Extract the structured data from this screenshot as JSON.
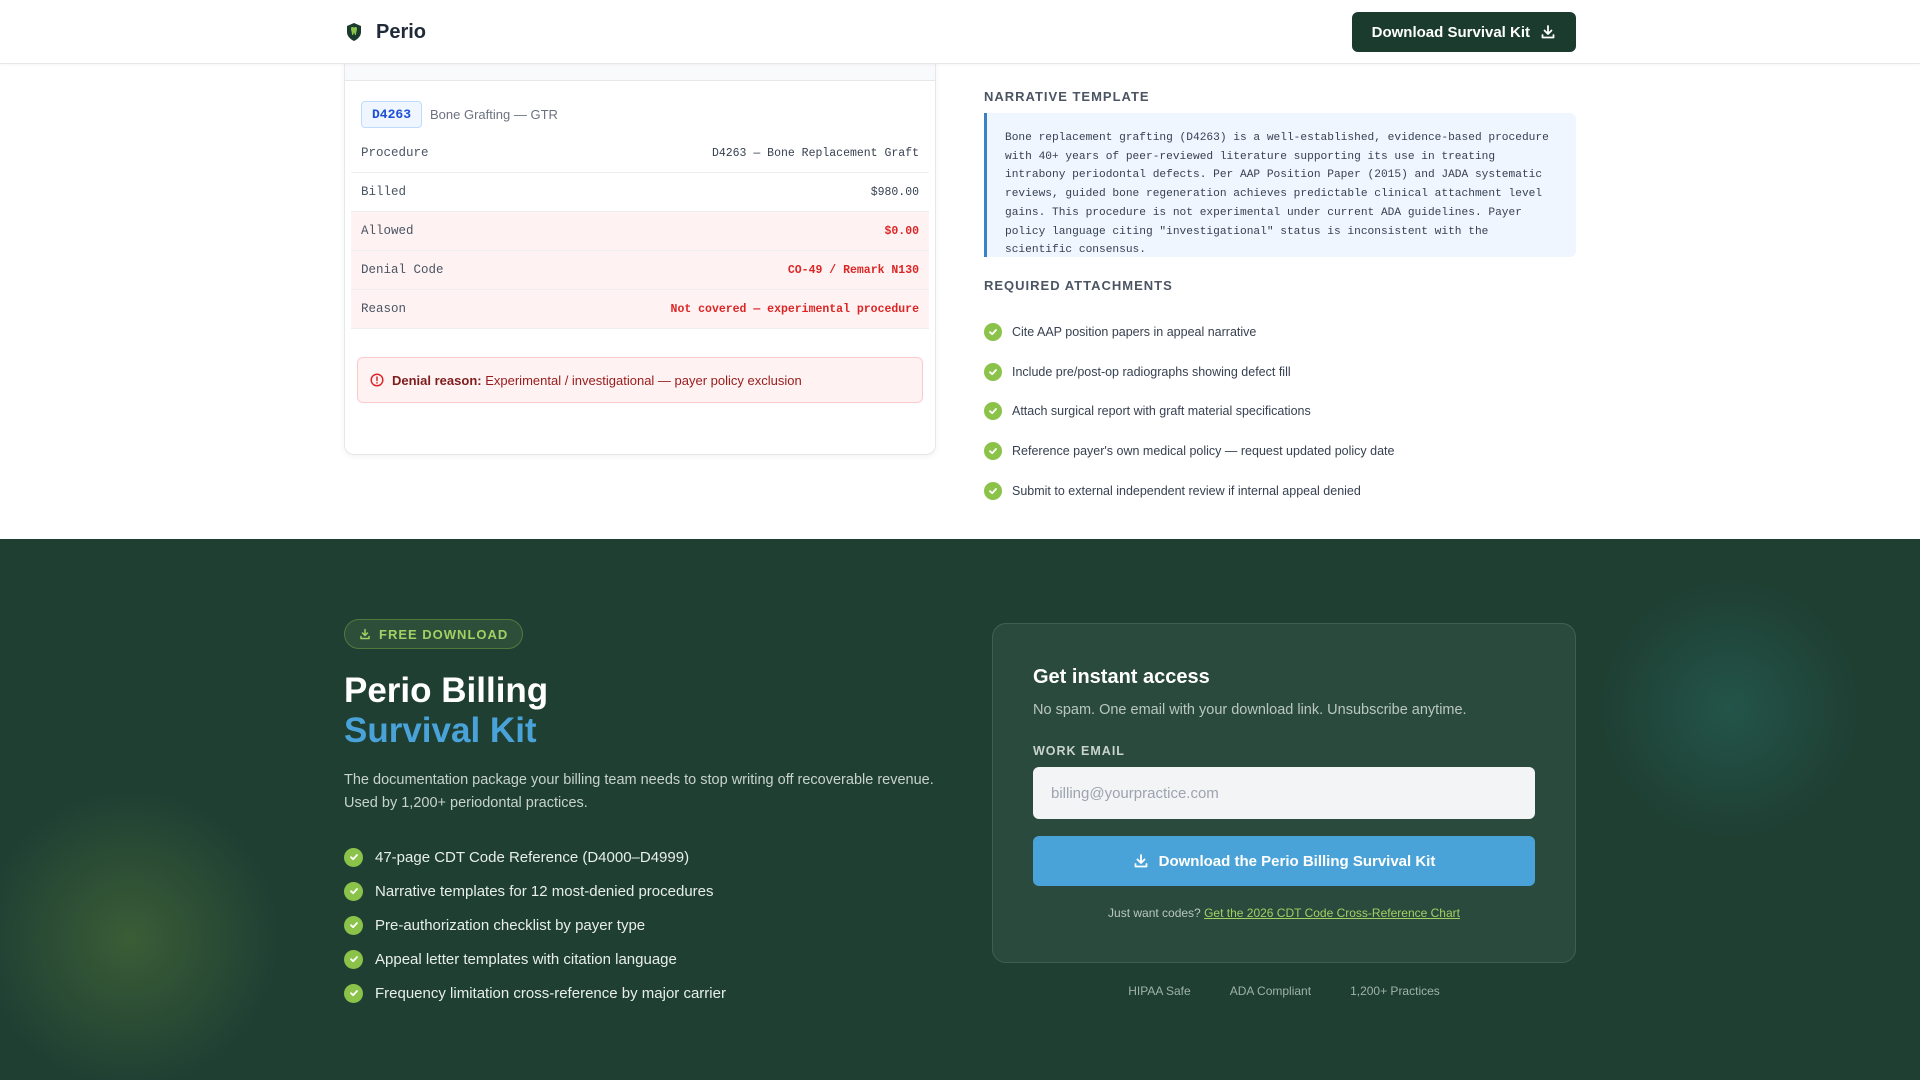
{
  "header": {
    "brand": "Perio",
    "cta_label": "Download Survival Kit",
    "logo_icon": "tooth-shield-icon"
  },
  "claim_card": {
    "code": "D4263",
    "code_description": "Bone Grafting — GTR",
    "rows": [
      {
        "label": "Procedure",
        "value": "D4263 — Bone Replacement Graft",
        "status": "normal"
      },
      {
        "label": "Billed",
        "value": "$980.00",
        "status": "normal"
      },
      {
        "label": "Allowed",
        "value": "$0.00",
        "status": "denied"
      },
      {
        "label": "Denial Code",
        "value": "CO-49 / Remark N130",
        "status": "denied"
      },
      {
        "label": "Reason",
        "value": "Not covered — experimental procedure",
        "status": "denied"
      }
    ],
    "denial_prefix": "Denial reason:",
    "denial_text": "Experimental / investigational — payer policy exclusion"
  },
  "narrative": {
    "label": "Narrative Template",
    "text": "Bone replacement grafting (D4263) is a well-established, evidence-based procedure with 40+ years of peer-reviewed literature supporting its use in treating intrabony periodontal defects. Per AAP Position Paper (2015) and JADA systematic reviews, guided bone regeneration achieves predictable clinical attachment level gains. This procedure is not experimental under current ADA guidelines. Payer policy language citing \"investigational\" status is inconsistent with the scientific consensus."
  },
  "attachments": {
    "label": "Required Attachments",
    "items": [
      "Cite AAP position papers in appeal narrative",
      "Include pre/post-op radiographs showing defect fill",
      "Attach surgical report with graft material specifications",
      "Reference payer's own medical policy — request updated policy date",
      "Submit to external independent review if internal appeal denied"
    ]
  },
  "promo": {
    "pill": "FREE DOWNLOAD",
    "title_line1": "Perio Billing",
    "title_line2": "Survival Kit",
    "description": "The documentation package your billing team needs to stop writing off recoverable revenue. Used by 1,200+ periodontal practices.",
    "features": [
      "47-page CDT Code Reference (D4000–D4999)",
      "Narrative templates for 12 most-denied procedures",
      "Pre-authorization checklist by payer type",
      "Appeal letter templates with citation language",
      "Frequency limitation cross-reference by major carrier"
    ]
  },
  "access": {
    "title": "Get instant access",
    "subtitle": "No spam. One email with your download link. Unsubscribe anytime.",
    "email_label": "WORK EMAIL",
    "email_placeholder": "billing@yourpractice.com",
    "email_value": "",
    "button_label": "Download the Perio Billing Survival Kit",
    "alt_prefix": "Just want codes?",
    "alt_link": "Get the 2026 CDT Code Cross-Reference Chart",
    "trust": [
      "HIPAA Safe",
      "ADA Compliant",
      "1,200+ Practices"
    ]
  },
  "colors": {
    "brand_dark": "#1b3b2f",
    "section_bg": "#1f3f33",
    "accent_blue": "#4aa3d8",
    "accent_green": "#8bc34a",
    "denied_red": "#dc2626"
  }
}
